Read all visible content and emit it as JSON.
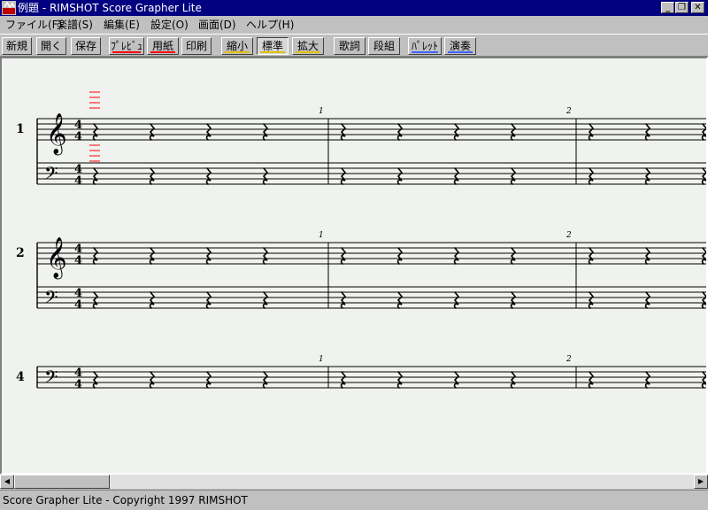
{
  "window": {
    "title": "例題 - RIMSHOT Score Grapher Lite"
  },
  "menu": [
    "ファイル(F)",
    "楽譜(S)",
    "編集(E)",
    "設定(O)",
    "画面(D)",
    "ヘルプ(H)"
  ],
  "toolbar": {
    "new": "新規",
    "open": "開く",
    "save": "保存",
    "preview": "ﾌﾟﾚﾋﾞｭ",
    "paper": "用紙",
    "print": "印刷",
    "zoom_out": "縮小",
    "zoom_normal": "標準",
    "zoom_in": "拡大",
    "lyrics": "歌詞",
    "systems": "段組",
    "palette": "ﾊﾟﾚｯﾄ",
    "play": "演奏"
  },
  "score": {
    "time_sig": {
      "numerator": "4",
      "denominator": "4"
    },
    "systems": [
      {
        "label": "1",
        "staves": [
          "treble",
          "bass"
        ],
        "measure_numbers": [
          "1",
          "2"
        ]
      },
      {
        "label": "2",
        "staves": [
          "treble",
          "bass"
        ],
        "measure_numbers": [
          "1",
          "2"
        ]
      },
      {
        "label": "4",
        "staves": [
          "bass"
        ],
        "measure_numbers": [
          "1",
          "2"
        ]
      }
    ]
  },
  "status": {
    "text": "Score Grapher Lite - Copyright 1997 RIMSHOT"
  },
  "colors": {
    "title_bar": "#000080",
    "ledger": "#ff0000",
    "paper": "#eff2ee",
    "underline_red": "#ff0000",
    "underline_yellow": "#e0c000",
    "underline_blue": "#4060ff"
  }
}
